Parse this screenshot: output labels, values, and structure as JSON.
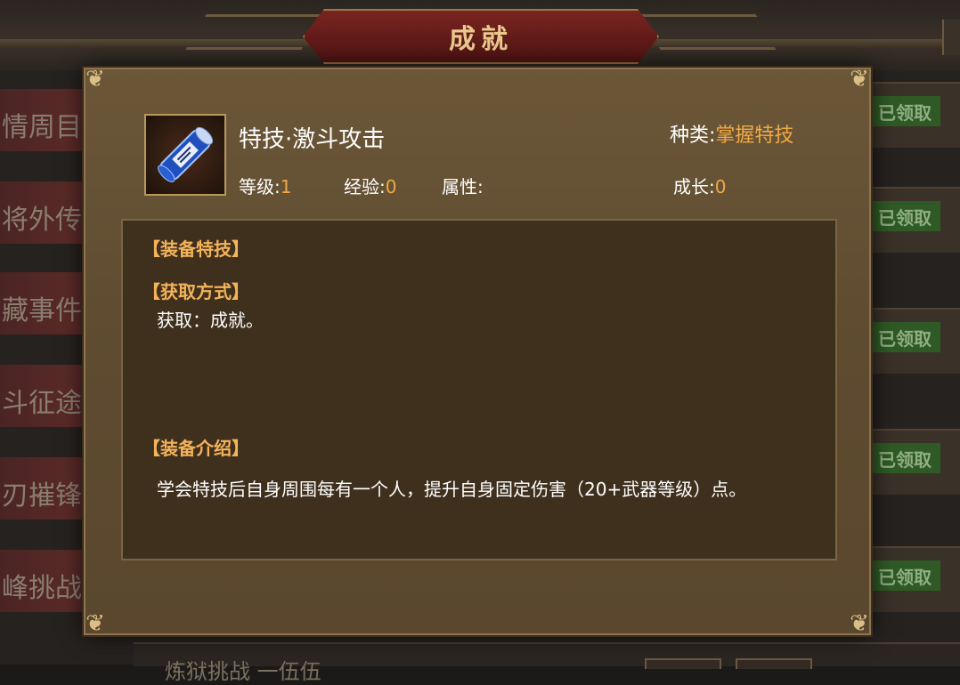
{
  "header": {
    "title": "成就"
  },
  "left_tabs": [
    "情周目",
    "将外传",
    "藏事件",
    "斗征途",
    "刃摧锋",
    "峰挑战"
  ],
  "right_badges": [
    "已领取",
    "已领取",
    "已领取",
    "已领取",
    "已领取"
  ],
  "bottom_text": "炼狱挑战 一伍伍",
  "popup": {
    "skill_name": "特技·激斗攻击",
    "category_label": "种类:",
    "category_value": "掌握特技",
    "level_label": "等级:",
    "level_value": "1",
    "exp_label": "经验:",
    "exp_value": "0",
    "attr_label": "属性:",
    "growth_label": "成长:",
    "growth_value": "0",
    "section_equip_skill": "【装备特技】",
    "section_obtain": "【获取方式】",
    "obtain_text": "获取：成就。",
    "section_intro": "【装备介绍】",
    "intro_text": "学会特技后自身周围每有一个人，提升自身固定伤害（20+武器等级）点。"
  },
  "icons": {
    "skill": "blue-scroll-icon",
    "corners": "scroll-ornament-icon"
  },
  "colors": {
    "highlight": "#f0a946",
    "section_title": "#f3b35a",
    "claim_badge": "#2f5a25"
  }
}
